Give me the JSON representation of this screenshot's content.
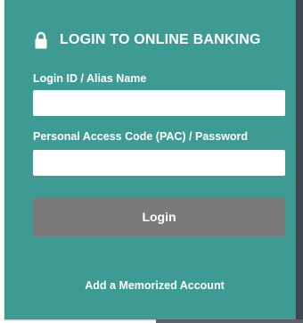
{
  "header": {
    "title": "LOGIN TO ONLINE BANKING",
    "icon": "lock-icon"
  },
  "form": {
    "login_label": "Login ID / Alias Name",
    "login_value": "",
    "pac_label": "Personal Access Code (PAC) / Password",
    "pac_value": ""
  },
  "actions": {
    "login_label": "Login",
    "memorized_label": "Add a Memorized Account"
  },
  "colors": {
    "panel": "#3d9b93",
    "button": "#7b7a78",
    "text": "#ffffff"
  }
}
